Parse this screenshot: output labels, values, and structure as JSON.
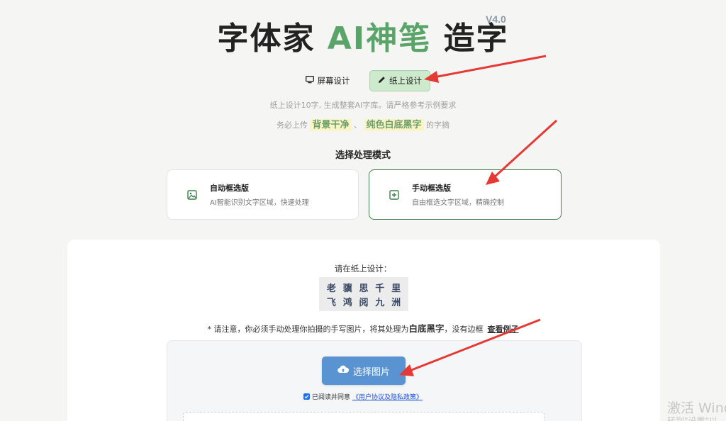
{
  "header": {
    "title_part1": "字体家 ",
    "title_accent": "AI神笔",
    "title_part2": " 造字",
    "version": "V4.0"
  },
  "modes": {
    "screen_label": "屏幕设计",
    "paper_label": "纸上设计",
    "active": "paper"
  },
  "hints": {
    "line1": "纸上设计10字, 生成整套AI字库。请严格参考示例要求",
    "line2_prefix": "务必上传",
    "highlight1": "背景干净",
    "separator": "、",
    "highlight2": "纯色白底黑字",
    "line2_suffix": "的字摘"
  },
  "process": {
    "section_title": "选择处理模式",
    "auto": {
      "title": "自动框选版",
      "desc": "AI智能识别文字区域，快速处理"
    },
    "manual": {
      "title": "手动框选版",
      "desc": "自由框选文字区域，精确控制"
    },
    "selected": "manual"
  },
  "upload": {
    "design_label": "请在纸上设计：",
    "sample_chars": [
      "老",
      "骥",
      "思",
      "千",
      "里",
      "飞",
      "鸿",
      "阅",
      "九",
      "洲"
    ],
    "notice_prefix": "* 请注意，你必须手动处理你拍摄的手写图片，将其处理为",
    "notice_bold": "白底黑字",
    "notice_suffix": "，没有边框",
    "example_link": "查看例子",
    "choose_button": "选择图片",
    "agree_text": "已阅读并同意",
    "agree_link": "《用户协议及隐私政策》",
    "agree_checked": true
  },
  "watermark": {
    "line1": "激活 Windo",
    "line2": "转到\"设置\"以"
  },
  "colors": {
    "accent_green": "#5aa469",
    "button_blue": "#5a93d2",
    "annotation_red": "#e53935"
  }
}
